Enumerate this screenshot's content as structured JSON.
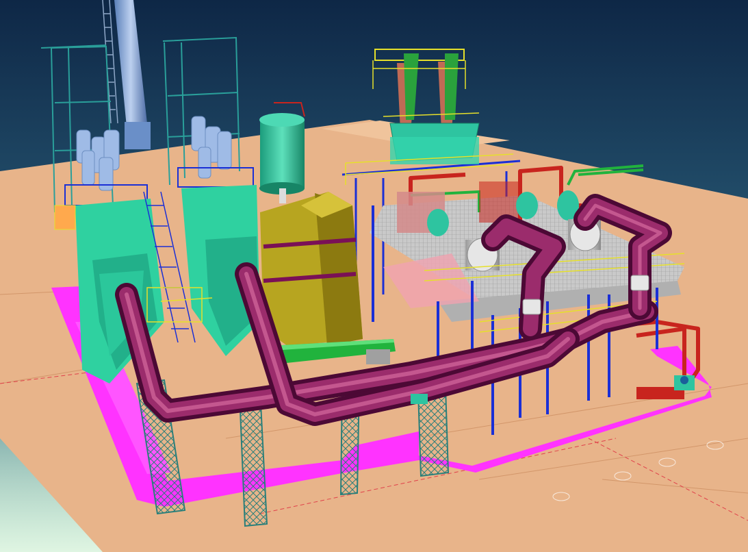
{
  "scene": {
    "colors": {
      "sky_top": "#0f2a49",
      "sky_bottom": "#4a8a9a",
      "horizon_glow": "#bfe8d6",
      "ground": "#e8b48a",
      "ground_edge": "#f2c9a5",
      "pad_magenta": "#ff33ff",
      "pipe_purple": "#7a1056",
      "pipe_purple_hi": "#b0407f",
      "structure_teal": "#2fd1a0",
      "structure_teal_dark": "#159a72",
      "steel_blue": "#1a2fd6",
      "handrail_yellow": "#e6e02a",
      "olive_casing": "#b7a520",
      "olive_casing_dark": "#8c7a10",
      "tank_green": "#2ec4a0",
      "stack_blue": "#7fa2d8",
      "duct_green": "#21b33d",
      "pipe_red": "#c8241e",
      "lattice_teal": "#2a7f7a",
      "deck_grey": "#c9c9c9",
      "silver": "#dcdcdc"
    },
    "equipment": [
      {
        "name": "exhaust-stack",
        "color": "#7fa2d8"
      },
      {
        "name": "boiler-house-left",
        "color": "#2fd1a0"
      },
      {
        "name": "boiler-house-right",
        "color": "#2fd1a0"
      },
      {
        "name": "storage-tank",
        "color": "#2ec4a0"
      },
      {
        "name": "olive-casing",
        "color": "#b7a520"
      },
      {
        "name": "heat-exchanger-1",
        "color": "#dcdcdc"
      },
      {
        "name": "heat-exchanger-2",
        "color": "#dcdcdc"
      },
      {
        "name": "main-purple-duct",
        "color": "#7a1056"
      },
      {
        "name": "green-transfer-pipe",
        "color": "#21b33d"
      },
      {
        "name": "red-steam-piping",
        "color": "#c8241e"
      },
      {
        "name": "top-fan-tower",
        "color": "#2ec4a0"
      }
    ]
  }
}
